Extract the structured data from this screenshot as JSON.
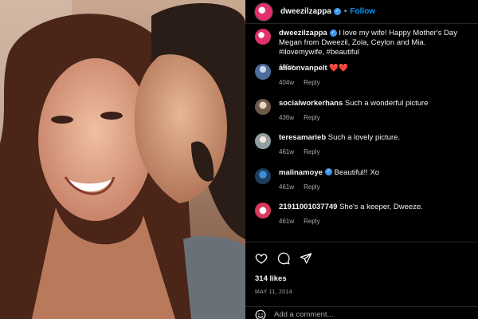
{
  "post": {
    "username": "dweezilzappa",
    "follow_label": "Follow",
    "separator": "•"
  },
  "caption": {
    "username": "dweezilzappa",
    "text": "I love my wife! Happy Mother's Day Megan from Dweezil, Zola, Ceylon and Mia. #ilovemywife, #beautiful",
    "time": "461w"
  },
  "comments": [
    {
      "username": "alisonvanpelt",
      "text": "❤️❤️",
      "time": "404w",
      "reply": "Reply"
    },
    {
      "username": "socialworkerhans",
      "text": "Such a wonderful picture",
      "time": "436w",
      "reply": "Reply"
    },
    {
      "username": "teresamarieb",
      "text": "Such a lovely picture.",
      "time": "461w",
      "reply": "Reply"
    },
    {
      "username": "malinamoye",
      "text": "Beautiful!! Xo",
      "time": "461w",
      "reply": "Reply"
    },
    {
      "username": "21911001037749",
      "text": "She's a keeper, Dweeze.",
      "time": "461w",
      "reply": "Reply"
    }
  ],
  "stats": {
    "likes": "314 likes",
    "date": "MAY 11, 2014"
  },
  "add_comment": {
    "placeholder": "Add a comment..."
  },
  "icons": {
    "like": "heart-icon",
    "comment": "comment-icon",
    "share": "share-icon",
    "emoji": "emoji-icon",
    "verified": "verified-badge-icon"
  },
  "colors": {
    "background": "#000000",
    "link": "#0095f6",
    "secondary_text": "#a8a8a8",
    "verified": "#3897f0"
  }
}
